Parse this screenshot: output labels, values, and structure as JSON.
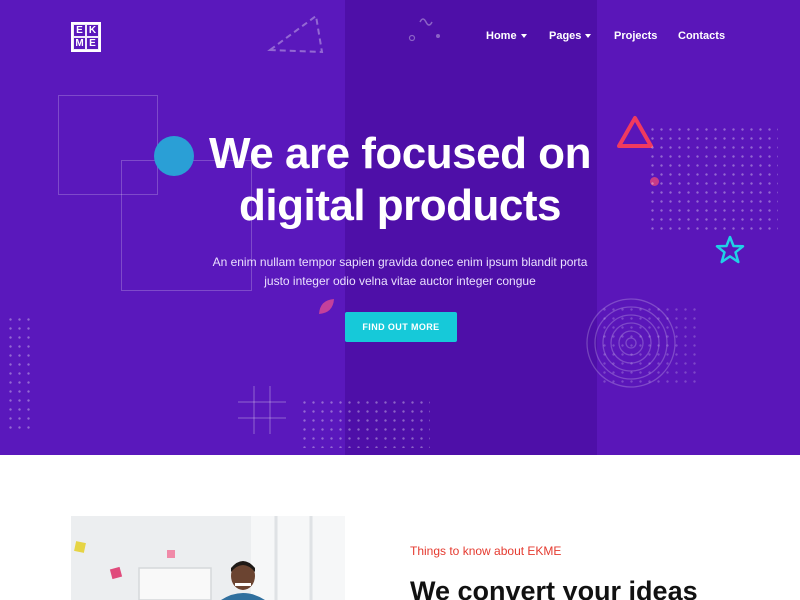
{
  "logo": {
    "letters": [
      "E",
      "K",
      "M",
      "E"
    ]
  },
  "nav": {
    "items": [
      {
        "label": "Home",
        "has_dropdown": true
      },
      {
        "label": "Pages",
        "has_dropdown": true
      },
      {
        "label": "Projects",
        "has_dropdown": false
      },
      {
        "label": "Contacts",
        "has_dropdown": false
      }
    ]
  },
  "hero": {
    "headline_line1": "We are focused on",
    "headline_line2": "digital products",
    "subtitle_line1": "An enim nullam tempor sapien gravida donec enim ipsum blandit porta",
    "subtitle_line2": "justo integer odio velna vitae auctor integer congue",
    "cta_label": "FIND OUT MORE"
  },
  "about": {
    "eyebrow": "Things to know about EKME",
    "title": "We convert your ideas"
  },
  "colors": {
    "hero_bg": "#5714b7",
    "accent_cyan": "#16c9d9",
    "accent_red": "#e53a2f",
    "triangle_pink": "#f03a5f",
    "star_cyan": "#1fd1e6"
  }
}
